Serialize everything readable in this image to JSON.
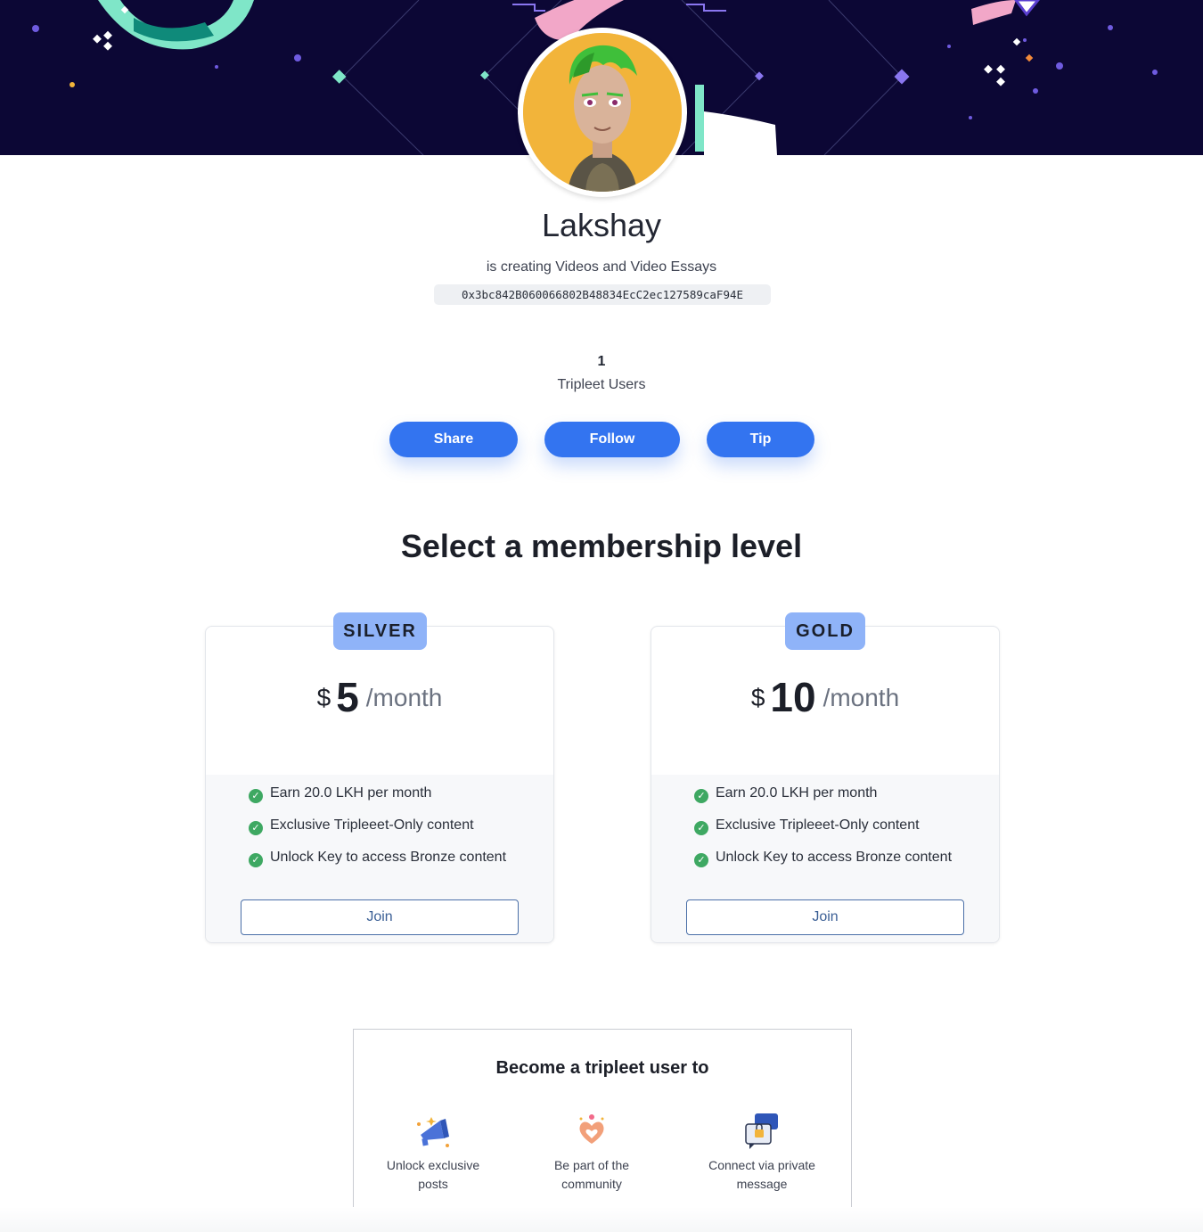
{
  "profile": {
    "name": "Lakshay",
    "tagline": "is creating Videos and Video Essays",
    "wallet_address": "0x3bc842B060066802B48834EcC2ec127589caF94E",
    "users_count": "1",
    "users_label": "Tripleet Users"
  },
  "actions": {
    "share": "Share",
    "follow": "Follow",
    "tip": "Tip"
  },
  "membership": {
    "title": "Select a membership level",
    "tiers": [
      {
        "name": "SILVER",
        "currency": "$",
        "price": "5",
        "period": "/month",
        "features": [
          "Earn 20.0 LKH per month",
          "Exclusive Tripleeet-Only content",
          "Unlock Key to access Bronze content"
        ],
        "cta": "Join"
      },
      {
        "name": "GOLD",
        "currency": "$",
        "price": "10",
        "period": "/month",
        "features": [
          "Earn 20.0 LKH per month",
          "Exclusive Tripleeet-Only content",
          "Unlock Key to access Bronze content"
        ],
        "cta": "Join"
      }
    ]
  },
  "benefits": {
    "title": "Become a tripleet user to",
    "items": [
      {
        "label_line1": "Unlock exclusive",
        "label_line2": "posts",
        "icon": "megaphone-icon"
      },
      {
        "label_line1": "Be part of the",
        "label_line2": "community",
        "icon": "heart-hands-icon"
      },
      {
        "label_line1": "Connect via private",
        "label_line2": "message",
        "icon": "private-message-icon"
      }
    ]
  },
  "colors": {
    "accent": "#3374f0",
    "banner": "#0c0735",
    "badge": "#8fb3f8",
    "check": "#3ea862"
  }
}
